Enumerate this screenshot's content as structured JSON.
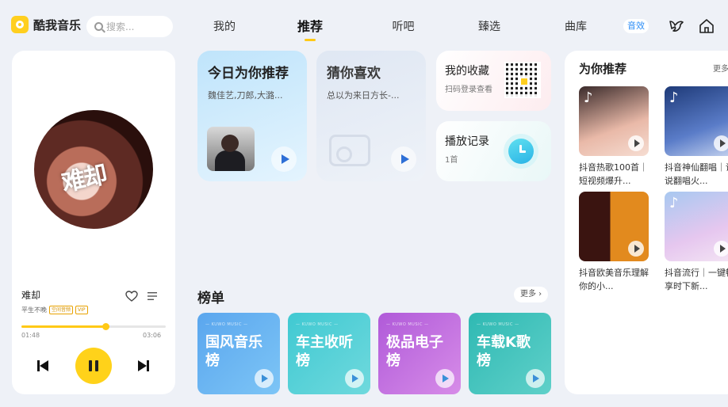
{
  "app": {
    "name": "酷我音乐",
    "accent": "#ffc916"
  },
  "search": {
    "placeholder": "搜索..."
  },
  "tabs": [
    {
      "label": "我的",
      "active": false
    },
    {
      "label": "推荐",
      "active": true
    },
    {
      "label": "听吧",
      "active": false
    },
    {
      "label": "臻选",
      "active": false
    },
    {
      "label": "曲库",
      "active": false
    }
  ],
  "header": {
    "sound_effect_label": "音效",
    "icons": [
      "bird-icon",
      "home-icon"
    ]
  },
  "player": {
    "song": "难却",
    "artist": "平生不晚",
    "badges": [
      "空间音频",
      "VIP"
    ],
    "current_time": "01:48",
    "total_time": "03:06",
    "progress": 0.58,
    "state": "playing"
  },
  "cards": {
    "daily": {
      "title": "今日为你推荐",
      "subtitle": "魏佳艺,刀郎,大潞..."
    },
    "guess": {
      "title": "猜你喜欢",
      "subtitle": "总以为来日方长-..."
    },
    "favorites": {
      "title": "我的收藏",
      "subtitle": "扫码登录查看"
    },
    "history": {
      "title": "播放记录",
      "subtitle": "1首"
    }
  },
  "charts": {
    "title": "榜单",
    "more_label": "更多",
    "items": [
      {
        "tag": "— KUWO MUSIC —",
        "name": "国风音乐榜",
        "color_from": "#5aa6ee",
        "color_to": "#7dc5f6"
      },
      {
        "tag": "— KUWO MUSIC —",
        "name": "车主收听榜",
        "color_from": "#40c9d2",
        "color_to": "#6fd9dd"
      },
      {
        "tag": "— KUWO MUSIC —",
        "name": "极品电子榜",
        "color_from": "#b05ad9",
        "color_to": "#d78ce8"
      },
      {
        "tag": "— KUWO MUSIC —",
        "name": "车载K歌榜",
        "color_from": "#2fb9b3",
        "color_to": "#5fd0c9"
      }
    ]
  },
  "recommend": {
    "title": "为你推荐",
    "more_label": "更多",
    "items": [
      {
        "caption": "抖音热歌100首｜短视频爆升..."
      },
      {
        "caption": "抖音神仙翻唱｜谁说翻唱火..."
      },
      {
        "caption": "抖音欧美音乐理解你的小..."
      },
      {
        "caption": "抖音流行｜一键畅享时下新..."
      }
    ]
  }
}
